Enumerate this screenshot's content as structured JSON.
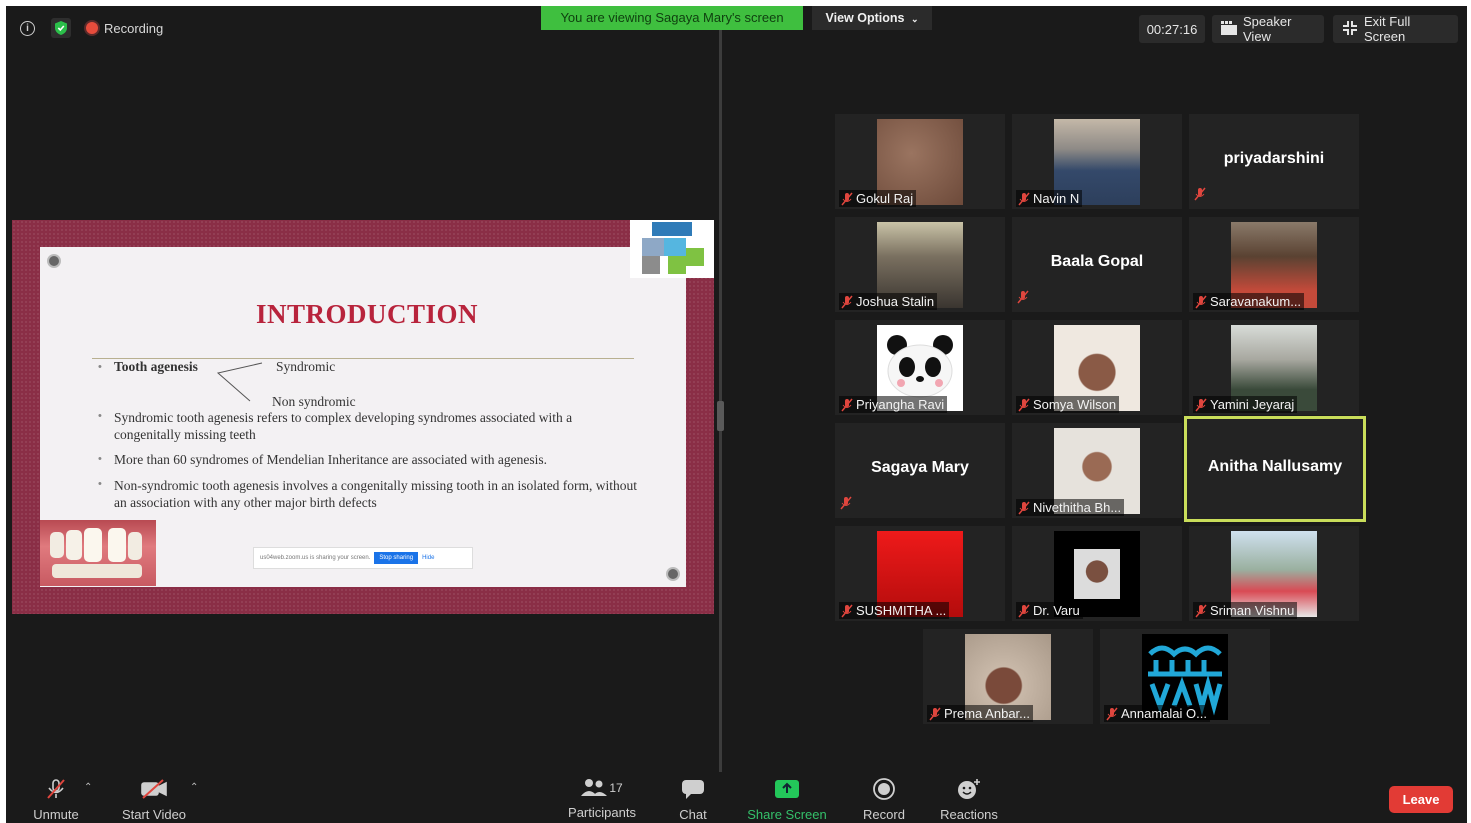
{
  "topbar": {
    "recording_label": "Recording",
    "viewing_banner": "You are viewing Sagaya Mary's screen",
    "view_options": "View Options",
    "timer": "00:27:16",
    "speaker_view": "Speaker View",
    "exit_full_screen": "Exit Full Screen"
  },
  "slide": {
    "title": "INTRODUCTION",
    "tooth_agenesis": "Tooth agenesis",
    "syndromic": "Syndromic",
    "non_syndromic": "Non syndromic",
    "bullet1": "Syndromic tooth agenesis refers to complex developing syndromes associated with a congenitally missing teeth",
    "bullet2": "More than 60 syndromes of Mendelian Inheritance  are associated with agenesis.",
    "bullet3": "Non-syndromic tooth agenesis involves a congenitally missing tooth in an isolated form, without an association with any other major birth defects",
    "sharing_text": "us04web.zoom.us is sharing your screen.",
    "stop_sharing": "Stop sharing",
    "hide": "Hide"
  },
  "participants": [
    {
      "name": "Gokul Raj"
    },
    {
      "name": "Navin N"
    },
    {
      "name": "priyadarshini"
    },
    {
      "name": "Joshua Stalin"
    },
    {
      "name": "Baala Gopal"
    },
    {
      "name": "Saravanakum..."
    },
    {
      "name": "Priyangha Ravi"
    },
    {
      "name": "Somya Wilson"
    },
    {
      "name": "Yamini Jeyaraj"
    },
    {
      "name": "Sagaya Mary"
    },
    {
      "name": "Nivethitha Bh..."
    },
    {
      "name": "Anitha Nallusamy"
    },
    {
      "name": "SUSHMITHA ..."
    },
    {
      "name": "Dr. Varu"
    },
    {
      "name": "Sriman Vishnu"
    },
    {
      "name": "Prema Anbar..."
    },
    {
      "name": "Annamalai O..."
    }
  ],
  "toolbar": {
    "unmute": "Unmute",
    "start_video": "Start Video",
    "participants": "Participants",
    "participant_count": "17",
    "chat": "Chat",
    "share_screen": "Share Screen",
    "record": "Record",
    "reactions": "Reactions",
    "leave": "Leave"
  }
}
